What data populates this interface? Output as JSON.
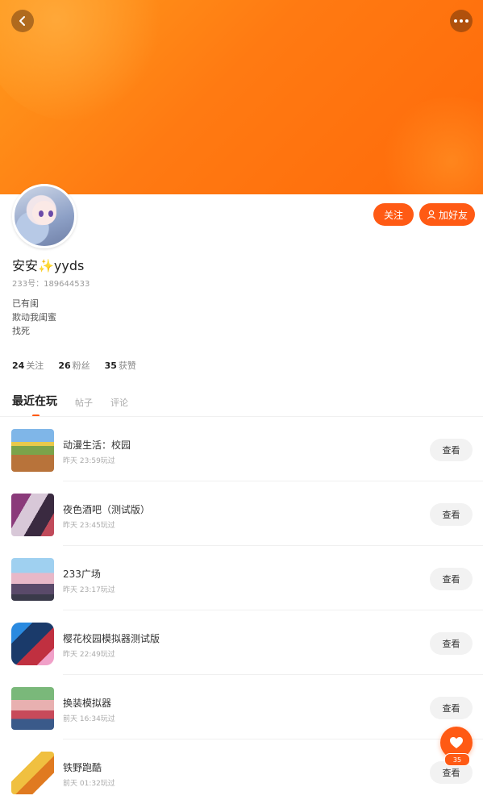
{
  "header": {
    "back_icon": "back-arrow-icon",
    "more_icon": "more-dots-icon",
    "banner_color": "#ff7a12"
  },
  "profile": {
    "username": "安安✨yyds",
    "uid": "233号：189644533",
    "bio": [
      "已有闺",
      "欺动我闺蜜",
      "找死"
    ],
    "follow_label": "关注",
    "add_friend_label": "加好友",
    "stats": [
      {
        "value": "24",
        "label": "关注"
      },
      {
        "value": "26",
        "label": "粉丝"
      },
      {
        "value": "35",
        "label": "获赞"
      }
    ]
  },
  "tabs": [
    {
      "label": "最近在玩",
      "active": true
    },
    {
      "label": "帖子",
      "active": false
    },
    {
      "label": "评论",
      "active": false
    }
  ],
  "games": [
    {
      "name": "动漫生活：校园",
      "time": "昨天 23:59玩过",
      "button": "查看"
    },
    {
      "name": "夜色酒吧（测试版）",
      "time": "昨天 23:45玩过",
      "button": "查看"
    },
    {
      "name": "233广场",
      "time": "昨天 23:17玩过",
      "button": "查看"
    },
    {
      "name": "樱花校园模拟器测试版",
      "time": "昨天 22:49玩过",
      "button": "查看"
    },
    {
      "name": "换装模拟器",
      "time": "前天 16:34玩过",
      "button": "查看"
    },
    {
      "name": "铁野跑酷",
      "time": "前天 01:32玩过",
      "button": "查看"
    }
  ],
  "like": {
    "icon": "heart-icon",
    "count": "35"
  },
  "accent_color": "#ff5a14"
}
